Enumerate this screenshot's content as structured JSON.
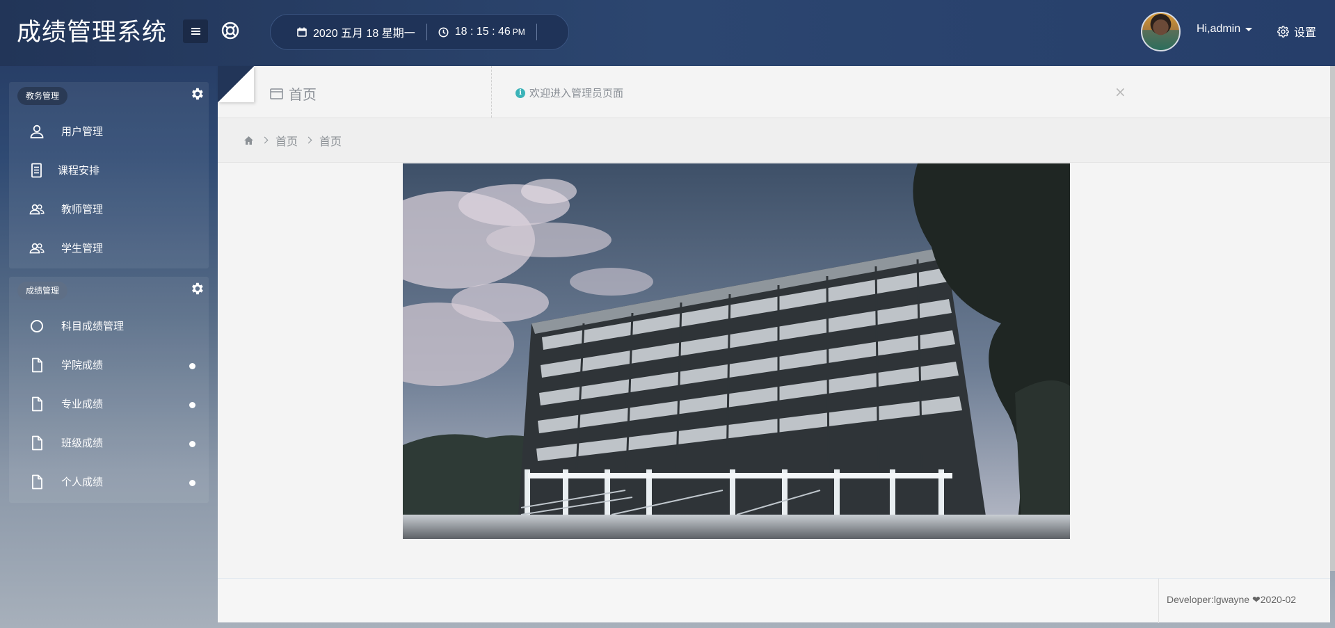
{
  "app": {
    "title": "成绩管理系统"
  },
  "header": {
    "date": "2020 五月 18 星期一",
    "time": "18 : 15 : 46",
    "ampm": "PM",
    "user_greeting": "Hi,admin",
    "settings_label": "设置"
  },
  "sidebar": {
    "groups": [
      {
        "label": "教务管理",
        "items": [
          {
            "label": "用户管理",
            "icon": "user-icon"
          },
          {
            "label": "课程安排",
            "icon": "document-list-icon"
          },
          {
            "label": "教师管理",
            "icon": "users-icon"
          },
          {
            "label": "学生管理",
            "icon": "users-icon"
          }
        ]
      },
      {
        "label": "成绩管理",
        "items": [
          {
            "label": "科目成绩管理",
            "icon": "circle-icon"
          },
          {
            "label": "学院成绩",
            "icon": "file-icon"
          },
          {
            "label": "专业成绩",
            "icon": "file-icon"
          },
          {
            "label": "班级成绩",
            "icon": "file-icon"
          },
          {
            "label": "个人成绩",
            "icon": "file-icon"
          }
        ]
      }
    ]
  },
  "main": {
    "tab_label": "首页",
    "welcome_text": "欢迎进入管理员页面",
    "close_symbol": "×",
    "breadcrumb": [
      "首页",
      "首页"
    ],
    "footer_text": "Developer:lgwayne ❤2020-02"
  },
  "colors": {
    "header_bg": "#223558",
    "main_bg": "#f4f4f4",
    "info_accent": "#3bb3b8"
  }
}
